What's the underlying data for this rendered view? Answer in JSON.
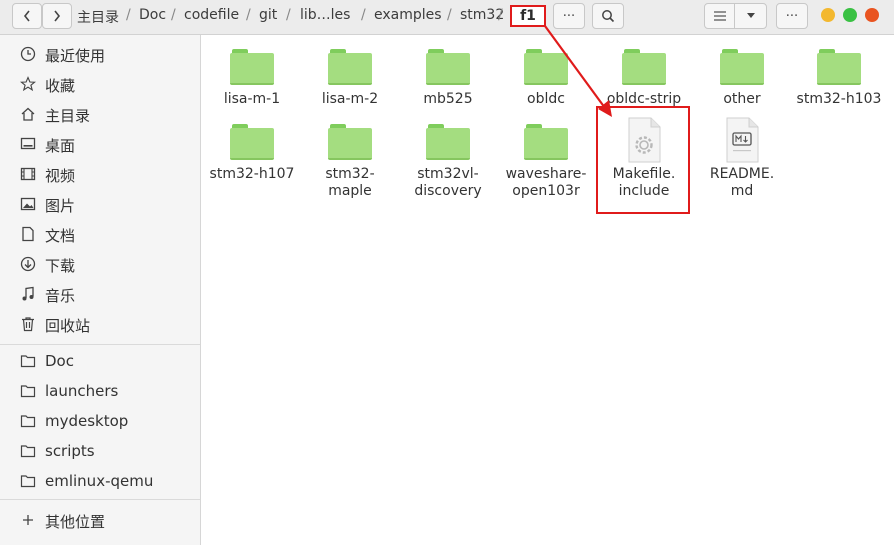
{
  "breadcrumb": {
    "items": [
      "主目录",
      "Doc",
      "codefile",
      "git",
      "lib…les",
      "examples",
      "stm32"
    ],
    "current": "f1",
    "separator": "/"
  },
  "toolbar": {
    "more_label": "···",
    "view_more_label": "···"
  },
  "sidebar": {
    "places": [
      {
        "icon": "clock-icon",
        "label": "最近使用"
      },
      {
        "icon": "star-icon",
        "label": "收藏"
      },
      {
        "icon": "home-icon",
        "label": "主目录"
      },
      {
        "icon": "desktop-icon",
        "label": "桌面"
      },
      {
        "icon": "video-icon",
        "label": "视频"
      },
      {
        "icon": "image-icon",
        "label": "图片"
      },
      {
        "icon": "document-icon",
        "label": "文档"
      },
      {
        "icon": "download-icon",
        "label": "下载"
      },
      {
        "icon": "music-icon",
        "label": "音乐"
      },
      {
        "icon": "trash-icon",
        "label": "回收站"
      }
    ],
    "bookmarks": [
      {
        "icon": "folder-icon",
        "label": "Doc"
      },
      {
        "icon": "folder-icon",
        "label": "launchers"
      },
      {
        "icon": "folder-icon",
        "label": "mydesktop"
      },
      {
        "icon": "folder-icon",
        "label": "scripts"
      },
      {
        "icon": "folder-icon",
        "label": "emlinux-qemu"
      }
    ],
    "other": {
      "icon": "plus-icon",
      "label": "其他位置"
    }
  },
  "files": [
    {
      "name": "lisa-m-1",
      "type": "folder"
    },
    {
      "name": "lisa-m-2",
      "type": "folder"
    },
    {
      "name": "mb525",
      "type": "folder"
    },
    {
      "name": "obldc",
      "type": "folder"
    },
    {
      "name": "obldc-strip",
      "type": "folder"
    },
    {
      "name": "other",
      "type": "folder"
    },
    {
      "name": "stm32-h103",
      "type": "folder"
    },
    {
      "name": "stm32-h107",
      "type": "folder"
    },
    {
      "name": "stm32-\nmaple",
      "type": "folder"
    },
    {
      "name": "stm32vl-\ndiscovery",
      "type": "folder"
    },
    {
      "name": "waveshare-\nopen103r",
      "type": "folder"
    },
    {
      "name": "Makefile.\ninclude",
      "type": "makefile"
    },
    {
      "name": "README.\nmd",
      "type": "markdown"
    }
  ],
  "colors": {
    "folder": "#a4dd80",
    "annotation": "#e01b1b",
    "close": "#e95420",
    "maximize": "#3ac143",
    "minimize": "#f3b82f"
  }
}
